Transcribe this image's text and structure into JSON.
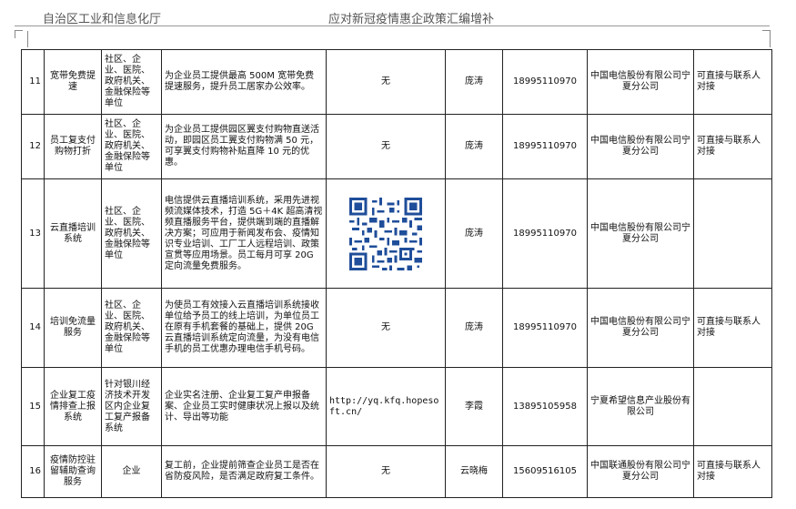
{
  "header": {
    "left": "自治区工业和信息化厅",
    "right": "应对新冠疫情惠企政策汇编增补"
  },
  "rows": [
    {
      "no": "11",
      "name": "宽带免费提速",
      "target": "社区、企业、医院、政府机关、金融保险等单位",
      "content": "为企业员工提供最高 500M 宽带免费提速服务，提升员工居家办公效率。",
      "channel": "无",
      "contact": "庞涛",
      "phone": "18995110970",
      "org": "中国电信股份有限公司宁夏分公司",
      "note": "可直接与联系人对接"
    },
    {
      "no": "12",
      "name": "员工复支付购物打折",
      "target": "社区、企业、医院、政府机关、金融保险等单位",
      "content": "为企业员工提供园区翼支付购物直送活动，即园区员工翼支付购物满 50 元，可享翼支付购物补贴直降 10 元的优惠。",
      "channel": "无",
      "contact": "庞涛",
      "phone": "18995110970",
      "org": "中国电信股份有限公司宁夏分公司",
      "note": "可直接与联系人对接"
    },
    {
      "no": "13",
      "name": "云直播培训系统",
      "target": "社区、企业、医院、政府机关、金融保险等单位",
      "content": "电信提供云直播培训系统，采用先进视频流媒体技术，打造 5G＋4K 超高清视频直播服务平台，提供端到端的直播解决方案；可应用于新闻发布会、疫情知识专业培训、工厂工人远程培训、政策宣贯等应用场景。员工每月可享 20G 定向流量免费服务。",
      "channel": "",
      "contact": "庞涛",
      "phone": "18995110970",
      "org": "中国电信股份有限公司宁夏分公司",
      "note": ""
    },
    {
      "no": "14",
      "name": "培训免流量服务",
      "target": "社区、企业、医院、政府机关、金融保险等单位",
      "content": "为使员工有效接入云直播培训系统接收单位给予员工的线上培训，为单位员工在原有手机套餐的基础上，提供 20G 云直播培训系统定向流量，为没有电信手机的员工优惠办理电信手机号码。",
      "channel": "无",
      "contact": "庞涛",
      "phone": "18995110970",
      "org": "中国电信股份有限公司宁夏分公司",
      "note": "可直接与联系人对接"
    },
    {
      "no": "15",
      "name": "企业复工疫情排查上报系统",
      "target": "针对银川经济技术开发区内企业复工复产报备系统",
      "content": "企业实名注册、企业复工复产申报备案、企业员工实时健康状况上报以及统计、导出等功能",
      "channel": "http://yq.kfq.hopesoft.cn/",
      "contact": "李霞",
      "phone": "13895105958",
      "org": "宁夏希望信息产业股份有限公司",
      "note": ""
    },
    {
      "no": "16",
      "name": "疫情防控驻留辅助查询服务",
      "target": "企业",
      "content": "复工前，企业提前筛查企业员工是否在省防疫风险，是否满足政府复工条件。",
      "channel": "无",
      "contact": "云晓梅",
      "phone": "15609516105",
      "org": "中国联通股份有限公司宁夏分公司",
      "note": "可直接与联系人对接"
    }
  ]
}
